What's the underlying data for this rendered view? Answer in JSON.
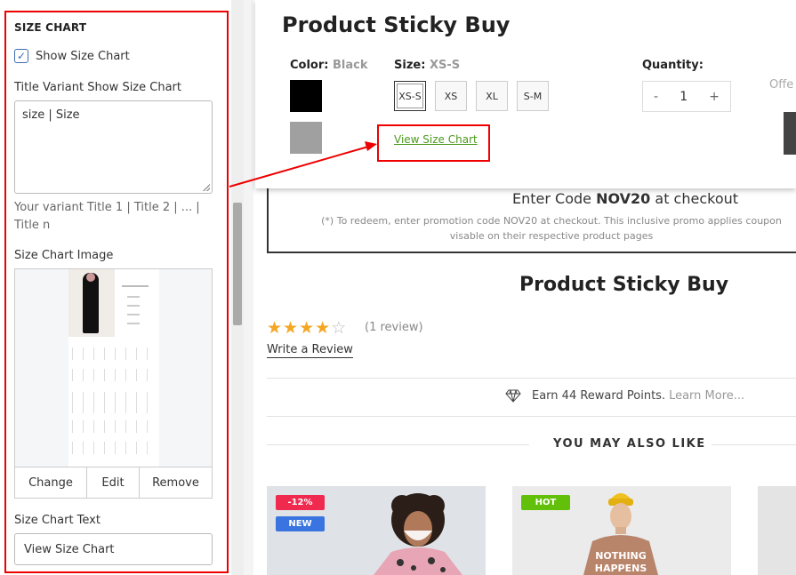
{
  "settings": {
    "section_title": "SIZE CHART",
    "show_size_chart_label": "Show Size Chart",
    "show_size_chart_checked": true,
    "title_variant_label": "Title Variant Show Size Chart",
    "title_variant_value": "size | Size",
    "title_variant_help": "Your variant Title 1 | Title 2 | ... | Title n",
    "image_label": "Size Chart Image",
    "image_buttons": [
      "Change",
      "Edit",
      "Remove"
    ],
    "text_label": "Size Chart Text",
    "text_value": "View Size Chart"
  },
  "sticky_bar": {
    "title": "Product Sticky Buy",
    "color_label": "Color:",
    "color_value": "Black",
    "size_label": "Size:",
    "size_value": "XS-S",
    "sizes": [
      "XS-S",
      "XS",
      "XL",
      "S-M"
    ],
    "quantity_label": "Quantity:",
    "quantity_value": "1",
    "qty_minus": "-",
    "qty_plus": "+",
    "offer_text": "Offe",
    "view_size_chart_link": "View Size Chart",
    "swatch_colors": [
      "#000000",
      "#a0a0a0"
    ]
  },
  "promo": {
    "main_prefix": "Enter Code ",
    "main_code": "NOV20",
    "main_suffix": " at checkout",
    "small_text": "(*) To redeem, enter promotion code NOV20 at checkout. This inclusive promo applies coupon visable on their respective product pages"
  },
  "product": {
    "title": "Product Sticky Buy",
    "rating": 4,
    "rating_max": 5,
    "review_count": "(1 review)",
    "write_review": "Write a Review",
    "reward_text": "Earn 44 Reward Points.",
    "reward_learn": "Learn More...",
    "also_like": "YOU MAY ALSO LIKE"
  },
  "cards": [
    {
      "badges": [
        {
          "text": "-12%",
          "color": "#f0294f"
        },
        {
          "text": "NEW",
          "color": "#3a74e0"
        }
      ]
    },
    {
      "badges": [
        {
          "text": "HOT",
          "color": "#62c00a"
        }
      ],
      "shirt_text_1": "NOTHING",
      "shirt_text_2": "HAPPENS"
    }
  ],
  "colors": {
    "highlight": "#e00000",
    "link_green": "#4a9a1c",
    "star": "#f5a623"
  }
}
